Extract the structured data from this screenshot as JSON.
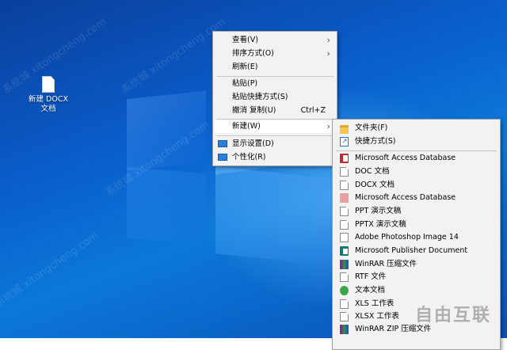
{
  "desktop": {
    "file_label_line1": "新建 DOCX",
    "file_label_line2": "文档"
  },
  "context_menu": {
    "items": [
      {
        "label": "查看(V)",
        "has_submenu": true
      },
      {
        "label": "排序方式(O)",
        "has_submenu": true
      },
      {
        "label": "刷新(E)"
      },
      {
        "label": "粘贴(P)"
      },
      {
        "label": "粘贴快捷方式(S)"
      },
      {
        "label": "撤消 复制(U)",
        "shortcut": "Ctrl+Z"
      },
      {
        "label": "新建(W)",
        "has_submenu": true,
        "highlighted": true
      },
      {
        "label": "显示设置(D)",
        "icon": "display-icon"
      },
      {
        "label": "个性化(R)",
        "icon": "personalize-icon"
      }
    ]
  },
  "new_submenu": {
    "items": [
      {
        "label": "文件夹(F)",
        "icon": "folder-icon"
      },
      {
        "label": "快捷方式(S)",
        "icon": "shortcut-icon"
      },
      {
        "label": "Microsoft Access Database",
        "icon": "access-icon"
      },
      {
        "label": "DOC 文档",
        "icon": "doc-icon"
      },
      {
        "label": "DOCX 文档",
        "icon": "docx-icon"
      },
      {
        "label": "Microsoft Access Database",
        "icon": "access-icon"
      },
      {
        "label": "PPT 演示文稿",
        "icon": "ppt-icon"
      },
      {
        "label": "PPTX 演示文稿",
        "icon": "pptx-icon"
      },
      {
        "label": "Adobe Photoshop Image 14",
        "icon": "photoshop-icon"
      },
      {
        "label": "Microsoft Publisher Document",
        "icon": "publisher-icon"
      },
      {
        "label": "WinRAR 压缩文件",
        "icon": "winrar-icon"
      },
      {
        "label": "RTF 文件",
        "icon": "rtf-icon"
      },
      {
        "label": "文本文档",
        "icon": "text-icon"
      },
      {
        "label": "XLS 工作表",
        "icon": "xls-icon"
      },
      {
        "label": "XLSX 工作表",
        "icon": "xlsx-icon"
      },
      {
        "label": "WinRAR ZIP 压缩文件",
        "icon": "winrar-zip-icon"
      }
    ]
  },
  "watermark": {
    "text": "系统城 xitongcheng.com",
    "brand": "自由互联"
  },
  "colors": {
    "desktop_blue": "#0a5cc9",
    "menu_bg": "#f2f2f2",
    "highlight": "#ffffff"
  }
}
